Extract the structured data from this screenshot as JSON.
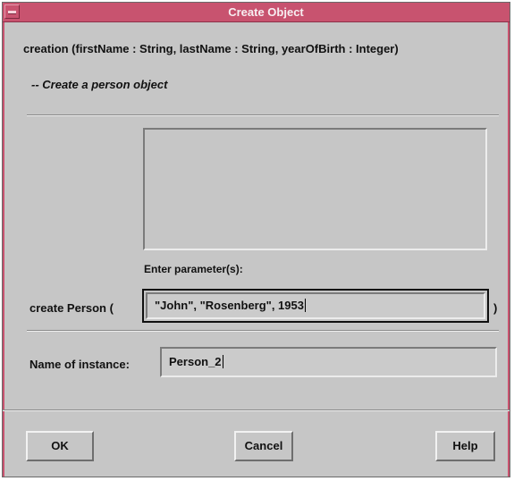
{
  "window": {
    "title": "Create Object",
    "accent_color": "#c8536f",
    "background_color": "#c6c6c6"
  },
  "operation": {
    "signature": "creation (firstName : String, lastName : String, yearOfBirth : Integer)",
    "comment": "-- Create a person object"
  },
  "parameters": {
    "list_items": [],
    "prompt": "Enter parameter(s):",
    "create_label": "create Person  (",
    "close_paren": ")",
    "value": "\"John\", \"Rosenberg\", 1953"
  },
  "instance": {
    "label": "Name of instance:",
    "value": "Person_2"
  },
  "buttons": {
    "ok": "OK",
    "cancel": "Cancel",
    "help": "Help"
  },
  "icons": {
    "window_menu": "window-menu-icon"
  }
}
